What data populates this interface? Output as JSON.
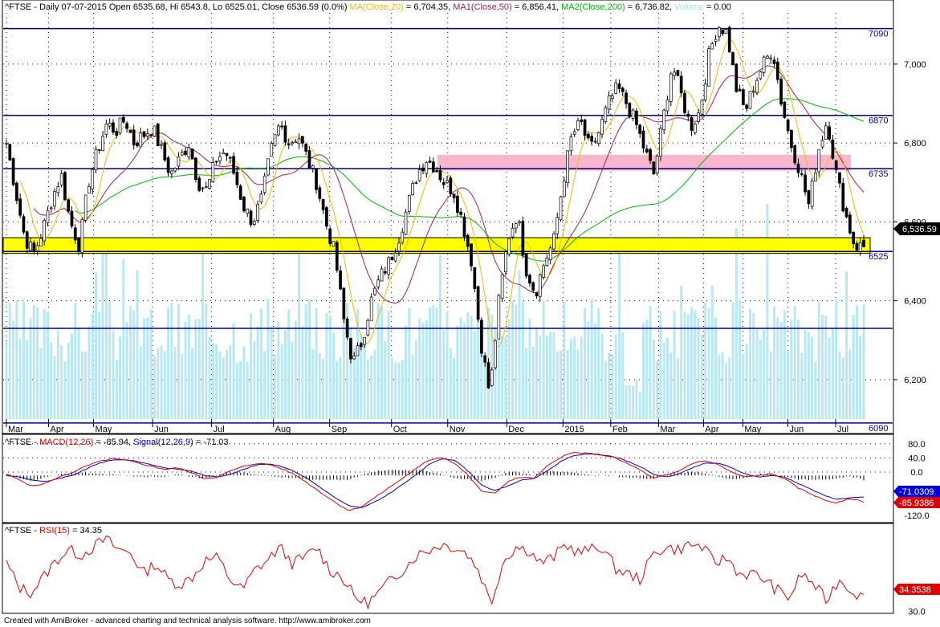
{
  "header": {
    "symbol": "^FTSE",
    "info": "^FTSE - Daily 07-07-2015 Open 6535.68, Hi 6543.8, Lo 6525.01, Close 6536.59 (0.0%)",
    "ma20_label": "MA(Close,20)",
    "ma20_value": " = 6,704.35,",
    "ma50_label": "MA1(Close,50)",
    "ma50_value": " = 6,856.41,",
    "ma200_label": "MA2(Close,200)",
    "ma200_value": " = 6,736.82,",
    "volume_label": "Volume",
    "volume_value": " = 0.00"
  },
  "colors": {
    "ma20": "#f0b800",
    "ma50": "#a0204a",
    "ma200": "#00b400",
    "volume": "#b8e8f4",
    "hline": "#00008b",
    "support_zone": "#ffff00",
    "resistance_zone": "#f9b6cc",
    "macd": "#e00000",
    "signal": "#0000c0",
    "rsi": "#e00000"
  },
  "price_panel": {
    "y_ticks": [
      "7,000",
      "6,800",
      "6,600",
      "6,400",
      "6,200"
    ],
    "level_labels": [
      "7090",
      "6870",
      "6735",
      "6525",
      "6090"
    ],
    "current_price": "6,536.59",
    "month_labels": [
      "Mar",
      "Apr",
      "May",
      "Jun",
      "Jul",
      "Aug",
      "Sep",
      "Oct",
      "Nov",
      "Dec",
      "2015",
      "Feb",
      "Mar",
      "Apr",
      "May",
      "Jun",
      "Jul"
    ]
  },
  "macd_panel": {
    "title": "^FTSE - ",
    "macd_label": "MACD(12,26)",
    "macd_value": " = -85.94, ",
    "signal_label": "Signal(12,26,9)",
    "signal_value": " = -71.03",
    "y_ticks": [
      "80.0",
      "40.0",
      "0.0",
      "-120.0"
    ],
    "signal_tag": "-71.0309",
    "macd_tag": "-85.9386"
  },
  "rsi_panel": {
    "title": "^FTSE - ",
    "rsi_label": "RSI(15)",
    "rsi_value": " = 34.35",
    "y_ticks": [
      "30.0"
    ],
    "rsi_tag": "34.3538"
  },
  "footer": {
    "text": "Created with AmiBroker - advanced charting and technical analysis software. http://www.amibroker.com"
  },
  "chart_data": [
    {
      "type": "candlestick",
      "title": "^FTSE - Daily 07-07-2015",
      "x_labels": [
        "Mar",
        "Apr",
        "May",
        "Jun",
        "Jul",
        "Aug",
        "Sep",
        "Oct",
        "Nov",
        "Dec",
        "2015",
        "Feb",
        "Mar",
        "Apr",
        "May",
        "Jun",
        "Jul"
      ],
      "ylim": [
        6100,
        7130
      ],
      "close_path": [
        6800,
        6680,
        6560,
        6520,
        6580,
        6660,
        6720,
        6600,
        6540,
        6700,
        6780,
        6850,
        6830,
        6860,
        6800,
        6820,
        6840,
        6780,
        6720,
        6760,
        6800,
        6700,
        6680,
        6760,
        6780,
        6720,
        6640,
        6600,
        6660,
        6780,
        6850,
        6800,
        6820,
        6760,
        6700,
        6600,
        6520,
        6350,
        6240,
        6300,
        6400,
        6460,
        6500,
        6560,
        6640,
        6720,
        6760,
        6740,
        6700,
        6680,
        6600,
        6500,
        6300,
        6160,
        6400,
        6560,
        6620,
        6480,
        6420,
        6500,
        6550,
        6700,
        6820,
        6850,
        6780,
        6830,
        6900,
        6940,
        6900,
        6850,
        6780,
        6720,
        6860,
        7000,
        6920,
        6840,
        6880,
        7020,
        7100,
        7080,
        6940,
        6880,
        6950,
        7000,
        7040,
        6900,
        6800,
        6730,
        6640,
        6780,
        6860,
        6720,
        6620,
        6540,
        6537
      ],
      "horizontal_levels": [
        7090,
        6870,
        6735,
        6525,
        6090,
        6330
      ],
      "support_zone": [
        6520,
        6560
      ],
      "resistance_zone": [
        6730,
        6770
      ],
      "series": [
        {
          "name": "MA(Close,20)",
          "last": 6704.35
        },
        {
          "name": "MA1(Close,50)",
          "last": 6856.41
        },
        {
          "name": "MA2(Close,200)",
          "last": 6736.82
        },
        {
          "name": "Volume",
          "last": 0.0
        }
      ],
      "last_bar": {
        "date": "07-07-2015",
        "open": 6535.68,
        "high": 6543.8,
        "low": 6525.01,
        "close": 6536.59
      }
    },
    {
      "type": "line",
      "title": "MACD(12,26)",
      "ylim": [
        -125,
        95
      ],
      "y_ticks": [
        80,
        40,
        0,
        -120
      ],
      "macd_path": [
        5,
        -15,
        -35,
        -25,
        -5,
        10,
        30,
        45,
        55,
        50,
        40,
        30,
        20,
        25,
        10,
        -10,
        -5,
        15,
        30,
        40,
        35,
        20,
        0,
        -30,
        -60,
        -90,
        -115,
        -100,
        -70,
        -40,
        -10,
        20,
        50,
        60,
        40,
        0,
        -50,
        -60,
        -20,
        -5,
        -10,
        30,
        60,
        75,
        72,
        68,
        60,
        40,
        20,
        -10,
        0,
        15,
        40,
        48,
        35,
        10,
        -5,
        0,
        5,
        -10,
        -40,
        -60,
        -80,
        -90,
        -75,
        -86
      ],
      "signal_path": [
        0,
        -5,
        -15,
        -20,
        -10,
        0,
        20,
        40,
        50,
        52,
        45,
        35,
        25,
        20,
        15,
        0,
        -5,
        5,
        20,
        35,
        38,
        28,
        10,
        -15,
        -45,
        -75,
        -100,
        -105,
        -85,
        -60,
        -30,
        0,
        35,
        55,
        50,
        15,
        -30,
        -50,
        -35,
        -15,
        -10,
        15,
        45,
        65,
        70,
        68,
        62,
        48,
        30,
        5,
        -5,
        5,
        25,
        40,
        40,
        25,
        5,
        -5,
        0,
        -5,
        -25,
        -45,
        -65,
        -78,
        -72,
        -71
      ],
      "series": [
        {
          "name": "MACD(12,26)",
          "last": -85.94
        },
        {
          "name": "Signal(12,26,9)",
          "last": -71.03
        }
      ]
    },
    {
      "type": "line",
      "title": "RSI(15)",
      "ylim": [
        25,
        80
      ],
      "y_ticks": [
        30
      ],
      "rsi_path": [
        60,
        42,
        38,
        50,
        62,
        70,
        66,
        72,
        78,
        70,
        68,
        52,
        60,
        48,
        44,
        50,
        62,
        64,
        48,
        40,
        55,
        62,
        72,
        60,
        64,
        72,
        55,
        50,
        35,
        30,
        38,
        48,
        56,
        66,
        70,
        74,
        72,
        68,
        55,
        30,
        62,
        72,
        70,
        60,
        64,
        74,
        68,
        70,
        72,
        56,
        52,
        48,
        66,
        72,
        70,
        74,
        72,
        60,
        64,
        52,
        52,
        48,
        40,
        34,
        52,
        44,
        32,
        48,
        40,
        34
      ],
      "series": [
        {
          "name": "RSI(15)",
          "last": 34.35
        }
      ]
    }
  ]
}
